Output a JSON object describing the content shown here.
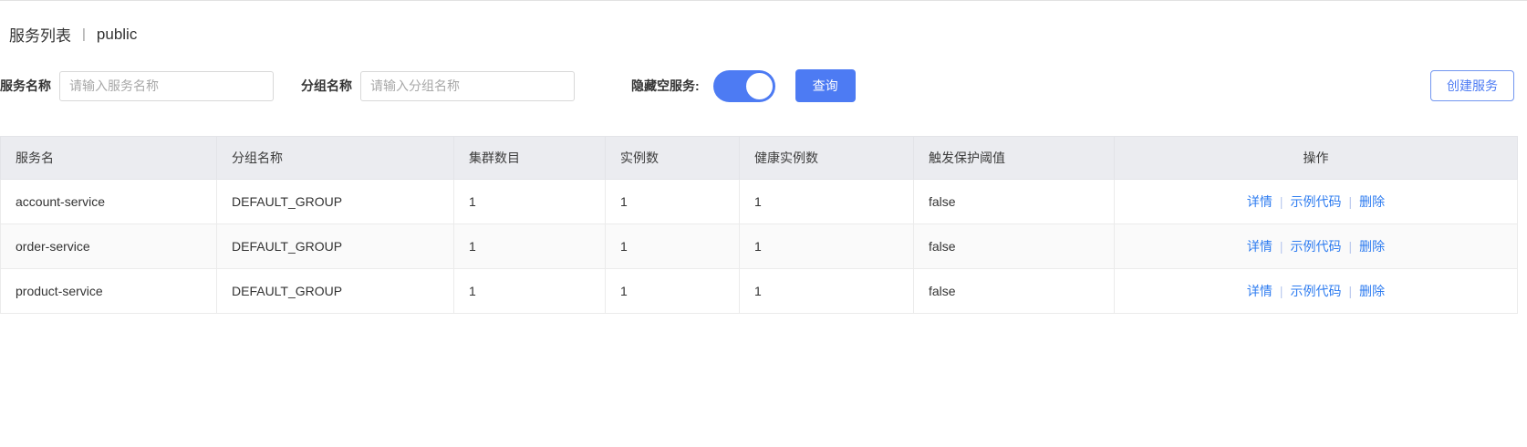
{
  "page": {
    "title": "服务列表",
    "title_separator": "|",
    "namespace": "public"
  },
  "toolbar": {
    "service_name_label": "服务名称",
    "service_name_placeholder": "请输入服务名称",
    "service_name_value": "",
    "group_name_label": "分组名称",
    "group_name_placeholder": "请输入分组名称",
    "group_name_value": "",
    "hide_empty_label": "隐藏空服务:",
    "hide_empty_state": "on",
    "query_button": "查询",
    "create_button": "创建服务"
  },
  "colors": {
    "primary": "#4d7bf3",
    "link": "#2e7cf0",
    "table_header_bg": "#ebecf0"
  },
  "table": {
    "headers": [
      "服务名",
      "分组名称",
      "集群数目",
      "实例数",
      "健康实例数",
      "触发保护阈值",
      "操作"
    ],
    "rows": [
      {
        "service_name": "account-service",
        "group": "DEFAULT_GROUP",
        "clusters": "1",
        "instances": "1",
        "healthy": "1",
        "threshold": "false"
      },
      {
        "service_name": "order-service",
        "group": "DEFAULT_GROUP",
        "clusters": "1",
        "instances": "1",
        "healthy": "1",
        "threshold": "false"
      },
      {
        "service_name": "product-service",
        "group": "DEFAULT_GROUP",
        "clusters": "1",
        "instances": "1",
        "healthy": "1",
        "threshold": "false"
      }
    ],
    "actions": [
      "详情",
      "示例代码",
      "删除"
    ],
    "action_separator": "|"
  }
}
